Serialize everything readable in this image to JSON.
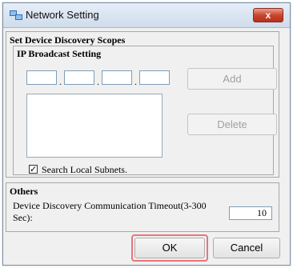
{
  "window": {
    "title": "Network Setting",
    "close_label": "x"
  },
  "scopes": {
    "title": "Set Device Discovery Scopes",
    "ip_broadcast": {
      "title": "IP Broadcast Setting",
      "octet_separator": ".",
      "octets": [
        "",
        "",
        "",
        ""
      ],
      "add_label": "Add",
      "delete_label": "Delete"
    },
    "search_local": {
      "label": "Search Local Subnets.",
      "checked": true,
      "mark": "✓"
    }
  },
  "others": {
    "title": "Others",
    "timeout_label": "Device Discovery Communication Timeout(3-300 Sec):",
    "timeout_value": "10"
  },
  "buttons": {
    "ok_label": "OK",
    "cancel_label": "Cancel"
  },
  "colors": {
    "close_button": "#c9452e",
    "highlight": "#e8757a"
  }
}
